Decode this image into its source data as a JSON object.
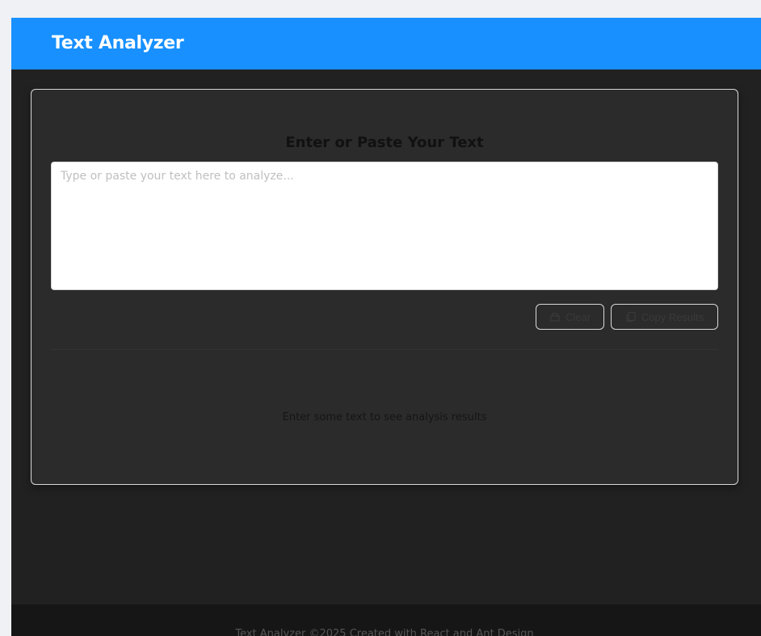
{
  "header": {
    "title": "Text Analyzer"
  },
  "main": {
    "heading": "Enter or Paste Your Text",
    "input": {
      "value": "",
      "placeholder": "Type or paste your text here to analyze..."
    },
    "buttons": {
      "clear_label": "Clear",
      "clear_icon": "clear-icon",
      "copy_label": "Copy Results",
      "copy_icon": "copy-icon"
    },
    "empty_message": "Enter some text to see analysis results"
  },
  "footer": {
    "text": "Text Analyzer ©2025 Created with React and Ant Design"
  },
  "colors": {
    "header_bg": "#1890ff",
    "page_bg": "#212121",
    "card_bg": "#2b2b2b"
  }
}
